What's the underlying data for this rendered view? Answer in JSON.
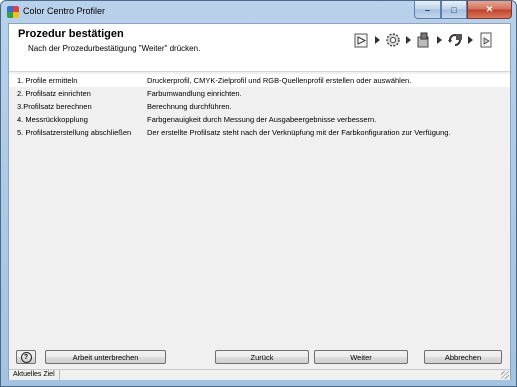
{
  "window": {
    "title": "Color Centro Profiler",
    "minimize_label": "–",
    "maximize_label": "□",
    "close_label": "✕"
  },
  "header": {
    "title": "Prozedur bestätigen",
    "subtitle": "Nach der Prozedurbestätigung \"Weiter\" drücken.",
    "step_icons": [
      "printer-profile-icon",
      "gear-icon",
      "measure-icon",
      "refresh-icon",
      "report-icon"
    ]
  },
  "steps": [
    {
      "name": "1. Profile ermitteln",
      "description": "Druckerprofil, CMYK-Zielprofil und RGB-Quellenprofil erstellen oder auswählen."
    },
    {
      "name": "2. Profilsatz einrichten",
      "description": "Farbumwandlung einrichten."
    },
    {
      "name": "3.Profilsatz berechnen",
      "description": "Berechnung durchführen."
    },
    {
      "name": "4. Messrückkopplung",
      "description": "Farbgenauigkeit durch Messung der Ausgabeergebnisse verbessern."
    },
    {
      "name": "5. Profilsatzerstellung abschließen",
      "description": "Der erstellte Profilsatz steht nach der Verknüpfung mit der Farbkonfiguration zur Verfügung."
    }
  ],
  "buttons": {
    "help": "?",
    "interrupt": "Arbeit unterbrechen",
    "back": "Zurück",
    "next": "Weiter",
    "cancel": "Abbrechen"
  },
  "status": {
    "label": "Aktuelles Ziel"
  }
}
